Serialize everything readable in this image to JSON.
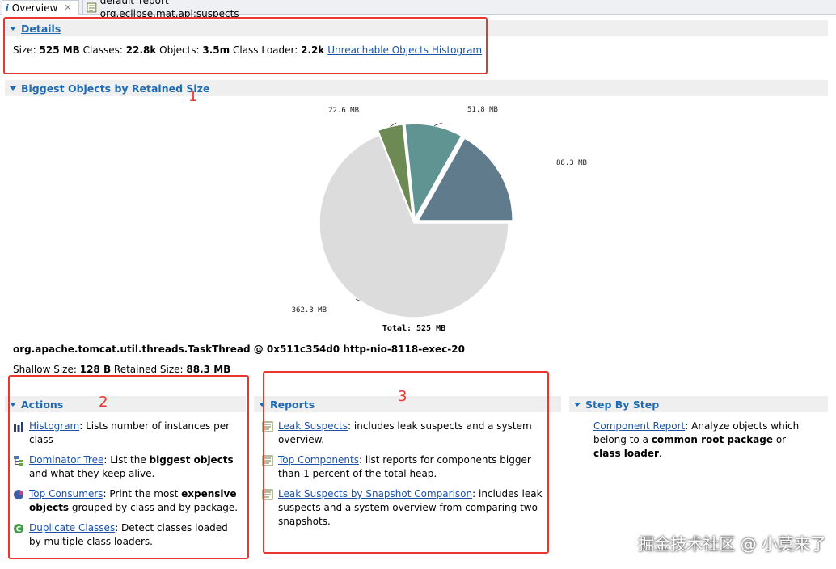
{
  "tabs": [
    {
      "label": "Overview",
      "icon": "info-icon",
      "active": true
    },
    {
      "label": "default_report  org.eclipse.mat.api:suspects",
      "icon": "report-icon",
      "active": false
    }
  ],
  "details": {
    "title": "Details",
    "size_label": "Size:",
    "size": "525 MB",
    "classes_label": "Classes:",
    "classes": "22.8k",
    "objects_label": "Objects:",
    "objects": "3.5m",
    "loader_label": "Class Loader:",
    "loader": "2.2k",
    "histogram_link": "Unreachable Objects Histogram"
  },
  "biggest": {
    "title": "Biggest Objects by Retained Size",
    "selected_object": "org.apache.tomcat.util.threads.TaskThread @ 0x511c354d0 http-nio-8118-exec-20",
    "shallow_label": "Shallow Size:",
    "shallow": "128 B",
    "retained_label": "Retained Size:",
    "retained": "88.3 MB"
  },
  "chart_data": {
    "type": "pie",
    "unit": "MB",
    "slices": [
      {
        "label": "88.3 MB",
        "value": 88.3,
        "color": "#5f7b8c"
      },
      {
        "label": "51.8 MB",
        "value": 51.8,
        "color": "#5f9493"
      },
      {
        "label": "22.6 MB",
        "value": 22.6,
        "color": "#6d8a55"
      },
      {
        "label": "362.3 MB",
        "value": 362.3,
        "color": "#dcdcdc"
      }
    ],
    "total_label": "Total: 525 MB",
    "total": 525
  },
  "actions": {
    "title": "Actions",
    "items": [
      {
        "link": "Histogram",
        "pre": ": Lists number of instances per class",
        "bold": "",
        "post": "",
        "icon": "histogram-icon"
      },
      {
        "link": "Dominator Tree",
        "pre": ": List the ",
        "bold": "biggest objects",
        "post": " and what they keep alive.",
        "icon": "dominator-tree-icon"
      },
      {
        "link": "Top Consumers",
        "pre": ": Print the most ",
        "bold": "expensive objects",
        "post": " grouped by class and by package.",
        "icon": "top-consumers-icon"
      },
      {
        "link": "Duplicate Classes",
        "pre": ": Detect classes loaded by multiple class loaders.",
        "bold": "",
        "post": "",
        "icon": "duplicate-classes-icon"
      }
    ]
  },
  "reports": {
    "title": "Reports",
    "items": [
      {
        "link": "Leak Suspects",
        "text": ": includes leak suspects and a system overview.",
        "icon": "report-icon"
      },
      {
        "link": "Top Components",
        "text": ": list reports for components bigger than 1 percent of the total heap.",
        "icon": "report-icon"
      },
      {
        "link": "Leak Suspects by Snapshot Comparison",
        "text": ": includes leak suspects and a system overview from comparing two snapshots.",
        "icon": "report-icon"
      }
    ]
  },
  "stepbystep": {
    "title": "Step By Step",
    "link": "Component Report",
    "pre": ": Analyze objects which belong to a ",
    "bold1": "common root package",
    "mid": " or ",
    "bold2": "class loader",
    "post": "."
  },
  "annotations": [
    "1",
    "2",
    "3"
  ],
  "watermark": "掘金技术社区 @ 小莫来了",
  "colors": {
    "accent": "#1f6bb3",
    "link": "#1c51a8",
    "annotation": "#e8372f"
  }
}
